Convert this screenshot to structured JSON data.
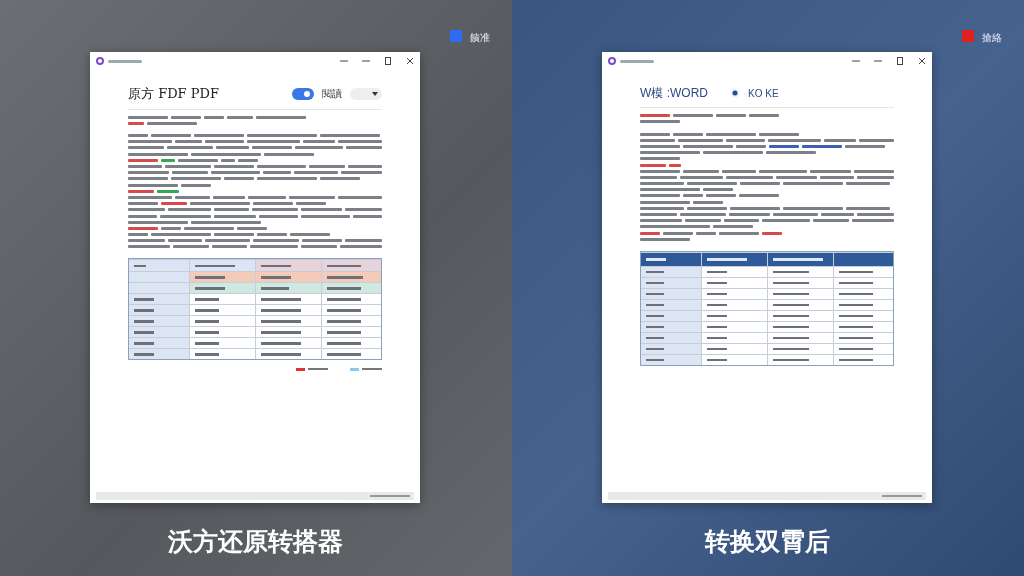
{
  "panels": [
    {
      "kind": "pdf",
      "legend": {
        "label": "饋准",
        "color": "#2f6bf0"
      },
      "heading": "原方 FDF PDF",
      "toggle": {
        "on": true
      },
      "mode_label": "閱讀",
      "caption": "沃方还原转搭器"
    },
    {
      "kind": "word",
      "legend": {
        "label": "搶絡",
        "color": "#e02020"
      },
      "heading": "W模 :WORD",
      "badge": "KO KE",
      "caption": "转换双霄后"
    }
  ]
}
